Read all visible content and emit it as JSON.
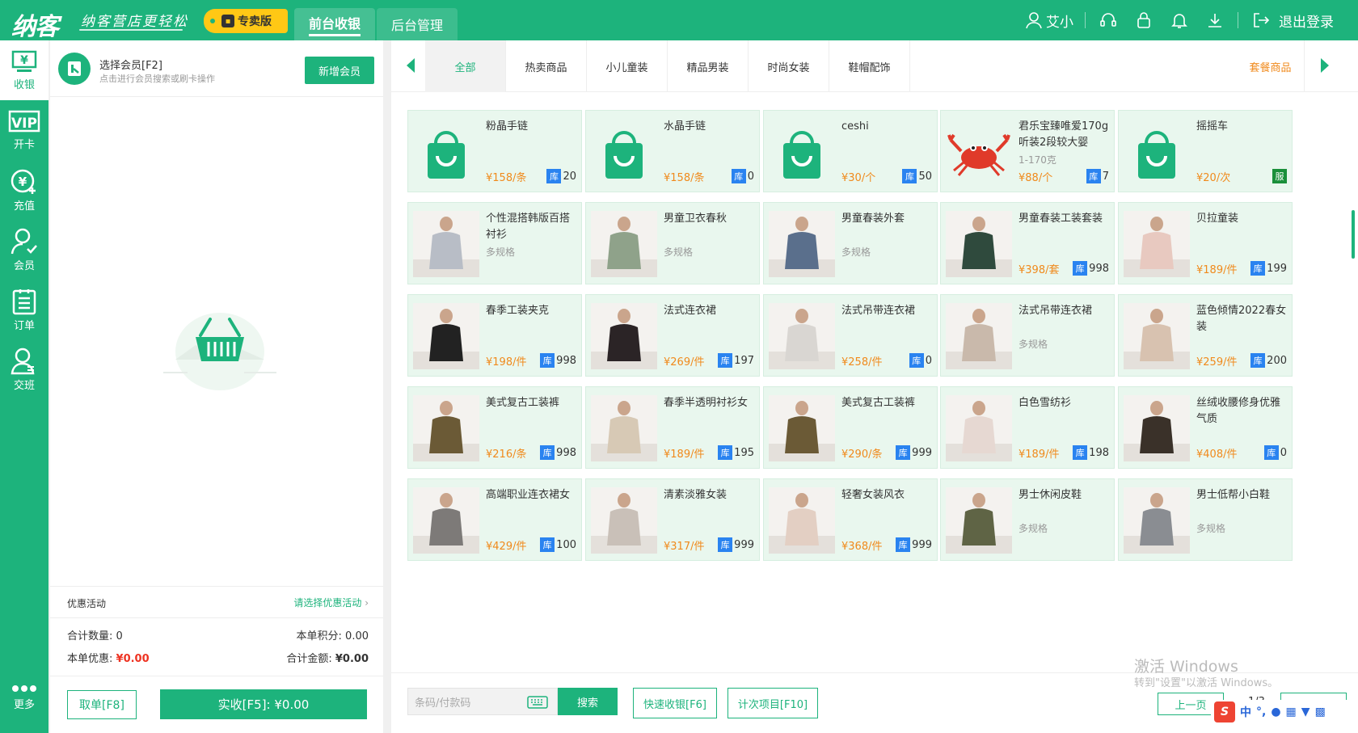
{
  "topbar": {
    "logo": "纳客",
    "slogan": "纳客营店更轻松",
    "edition": "专卖版",
    "tab_front": "前台收银",
    "tab_back": "后台管理",
    "username": "艾小",
    "logout": "退出登录"
  },
  "leftnav": [
    {
      "label": "收银",
      "icon": "cashier-icon"
    },
    {
      "label": "开卡",
      "icon": "vip-card-icon"
    },
    {
      "label": "充值",
      "icon": "recharge-icon"
    },
    {
      "label": "会员",
      "icon": "member-icon"
    },
    {
      "label": "订单",
      "icon": "order-icon"
    },
    {
      "label": "交班",
      "icon": "shift-icon"
    },
    {
      "label": "更多",
      "icon": "more-icon"
    }
  ],
  "cart": {
    "member_title": "选择会员[F2]",
    "member_hint": "点击进行会员搜索或刷卡操作",
    "add_member": "新增会员",
    "promo_label": "优惠活动",
    "promo_link": "请选择优惠活动",
    "total_qty_label": "合计数量:",
    "total_qty": "0",
    "points_label": "本单积分:",
    "points": "0.00",
    "discount_label": "本单优惠:",
    "discount": "¥0.00",
    "total_amount_label": "合计金额:",
    "total_amount": "¥0.00",
    "cancel": "取单[F8]",
    "pay": "实收[F5]: ¥0.00"
  },
  "categories": [
    "全部",
    "热卖商品",
    "小儿童装",
    "精品男装",
    "时尚女装",
    "鞋帽配饰"
  ],
  "combo_tab": "套餐商品",
  "products": [
    {
      "name": "粉晶手链",
      "price": "¥158/条",
      "stock": "20",
      "thumb": "bag"
    },
    {
      "name": "水晶手链",
      "price": "¥158/条",
      "stock": "0",
      "thumb": "bag"
    },
    {
      "name": "ceshi",
      "price": "¥30/个",
      "stock": "50",
      "thumb": "bag"
    },
    {
      "name": "君乐宝臻唯爱170g听装2段较大婴",
      "sub": "1-170克",
      "price": "¥88/个",
      "stock": "7",
      "thumb": "crab"
    },
    {
      "name": "摇摇车",
      "price": "¥20/次",
      "service": "服",
      "thumb": "bag"
    },
    {
      "name": "个性混搭韩版百搭衬衫",
      "sub": "多规格",
      "thumb": "photo",
      "color": "#b8bdc6"
    },
    {
      "name": "男童卫衣春秋",
      "sub": "多规格",
      "thumb": "photo",
      "color": "#8fa28a"
    },
    {
      "name": "男童春装外套",
      "sub": "多规格",
      "thumb": "photo",
      "color": "#5a6f8c"
    },
    {
      "name": "男童春装工装套装",
      "price": "¥398/套",
      "stock": "998",
      "thumb": "photo",
      "color": "#2f4a3d"
    },
    {
      "name": "贝拉童装",
      "price": "¥189/件",
      "stock": "199",
      "thumb": "photo",
      "color": "#e8c9c0"
    },
    {
      "name": "春季工装夹克",
      "price": "¥198/件",
      "stock": "998",
      "thumb": "photo",
      "color": "#222222"
    },
    {
      "name": "法式连衣裙",
      "price": "¥269/件",
      "stock": "197",
      "thumb": "photo",
      "color": "#2b2426"
    },
    {
      "name": "法式吊带连衣裙",
      "price": "¥258/件",
      "stock": "0",
      "thumb": "photo",
      "color": "#d9d6d2"
    },
    {
      "name": "法式吊带连衣裙",
      "sub": "多规格",
      "thumb": "photo",
      "color": "#c9b9ab"
    },
    {
      "name": "蓝色倾情2022春女装",
      "price": "¥259/件",
      "stock": "200",
      "thumb": "photo",
      "color": "#d8c2b0"
    },
    {
      "name": "美式复古工装裤",
      "price": "¥216/条",
      "stock": "998",
      "thumb": "photo",
      "color": "#6b5a36"
    },
    {
      "name": "春季半透明衬衫女",
      "price": "¥189/件",
      "stock": "195",
      "thumb": "photo",
      "color": "#d7c9b5"
    },
    {
      "name": "美式复古工装裤",
      "price": "¥290/条",
      "stock": "999",
      "thumb": "photo",
      "color": "#6b5a36"
    },
    {
      "name": "白色雪纺衫",
      "price": "¥189/件",
      "stock": "198",
      "thumb": "photo",
      "color": "#e6d8d2"
    },
    {
      "name": "丝绒收腰修身优雅气质",
      "price": "¥408/件",
      "stock": "0",
      "thumb": "photo",
      "color": "#3a3129"
    },
    {
      "name": "高端职业连衣裙女",
      "price": "¥429/件",
      "stock": "100",
      "thumb": "photo",
      "color": "#7d7a78"
    },
    {
      "name": "清素淡雅女装",
      "price": "¥317/件",
      "stock": "999",
      "thumb": "photo",
      "color": "#c9c0b8"
    },
    {
      "name": "轻奢女装风衣",
      "price": "¥368/件",
      "stock": "999",
      "thumb": "photo",
      "color": "#e3cfc3"
    },
    {
      "name": "男士休闲皮鞋",
      "sub": "多规格",
      "thumb": "photo",
      "color": "#5f6445"
    },
    {
      "name": "男士低帮小白鞋",
      "sub": "多规格",
      "thumb": "photo",
      "color": "#8a8d92"
    }
  ],
  "stock_tag": "库",
  "bottom": {
    "barcode_placeholder": "条码/付款码",
    "search": "搜索",
    "quick_pay": "快速收银[F6]",
    "count_item": "计次项目[F10]",
    "prev": "上一页",
    "page": "1/3",
    "next": "下一页",
    "watermark1": "激活 Windows",
    "watermark2": "转到\"设置\"以激活 Windows。",
    "ime_zh": "中",
    "ime_punc": "°,"
  },
  "colors": {
    "brand": "#1db37c",
    "price": "#f08a1c",
    "stock_tag": "#2a83f0",
    "discount": "#e32"
  }
}
